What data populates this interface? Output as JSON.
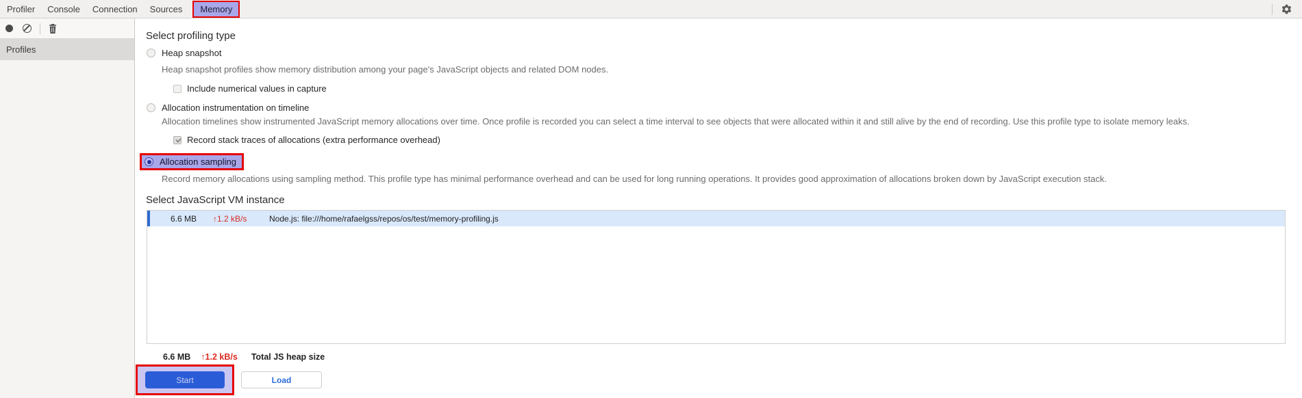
{
  "tabs": {
    "items": [
      {
        "label": "Profiler",
        "active": false
      },
      {
        "label": "Console",
        "active": false
      },
      {
        "label": "Connection",
        "active": false
      },
      {
        "label": "Sources",
        "active": false
      },
      {
        "label": "Memory",
        "active": true
      }
    ]
  },
  "toolbar": {
    "icons": [
      "record-icon",
      "clear-all-icon",
      "trash-icon"
    ]
  },
  "sidebar": {
    "header": "Profiles"
  },
  "main": {
    "profiling_type": {
      "heading": "Select profiling type",
      "options": [
        {
          "label": "Heap snapshot",
          "selected": false,
          "description": "Heap snapshot profiles show memory distribution among your page's JavaScript objects and related DOM nodes.",
          "checkbox": {
            "label": "Include numerical values in capture",
            "checked": false
          }
        },
        {
          "label": "Allocation instrumentation on timeline",
          "selected": false,
          "description": "Allocation timelines show instrumented JavaScript memory allocations over time. Once profile is recorded you can select a time interval to see objects that were allocated within it and still alive by the end of recording. Use this profile type to isolate memory leaks.",
          "checkbox": {
            "label": "Record stack traces of allocations (extra performance overhead)",
            "checked": true
          }
        },
        {
          "label": "Allocation sampling",
          "selected": true,
          "highlighted": true,
          "description": "Record memory allocations using sampling method. This profile type has minimal performance overhead and can be used for long running operations. It provides good approximation of allocations broken down by JavaScript execution stack."
        }
      ]
    },
    "vm_instance": {
      "heading": "Select JavaScript VM instance",
      "rows": [
        {
          "size": "6.6 MB",
          "rate": "↑1.2 kB/s",
          "name": "Node.js: file:///home/rafaelgss/repos/os/test/memory-profiling.js",
          "selected": true
        }
      ],
      "total": {
        "size": "6.6 MB",
        "rate": "↑1.2 kB/s",
        "label": "Total JS heap size"
      }
    },
    "actions": {
      "start_label": "Start",
      "load_label": "Load"
    }
  },
  "colors": {
    "highlight_red": "#e60000",
    "highlight_lavender": "#a9a6e9",
    "primary_button_blue": "#2a5cd7",
    "selected_row_bg": "#d9e8fb",
    "selected_row_bar": "#2f6cd0",
    "rate_red": "#d92b22"
  }
}
